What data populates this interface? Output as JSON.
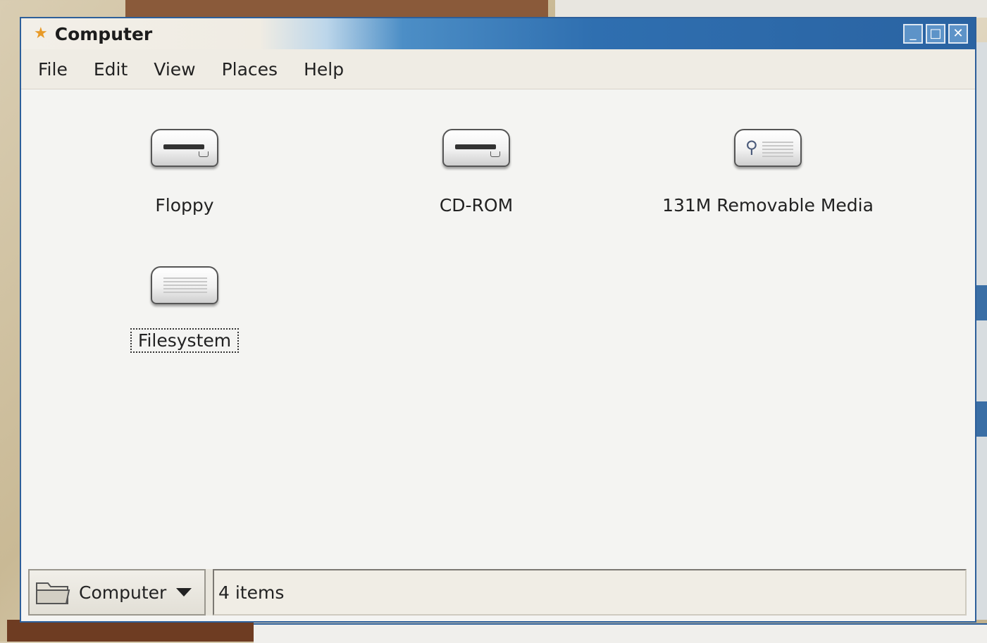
{
  "window": {
    "title": "Computer"
  },
  "menu": [
    "File",
    "Edit",
    "View",
    "Places",
    "Help"
  ],
  "icons": [
    {
      "label": "Floppy",
      "type": "floppy-drive"
    },
    {
      "label": "CD-ROM",
      "type": "cdrom-drive"
    },
    {
      "label": "131M Removable Media",
      "type": "usb-drive"
    },
    {
      "label": "Filesystem",
      "type": "hard-drive",
      "focused": true
    }
  ],
  "statusbar": {
    "location": "Computer",
    "items_text": "4 items"
  },
  "colors": {
    "title_accent": "#2f6fb0",
    "frame": "#2d5f9a"
  }
}
